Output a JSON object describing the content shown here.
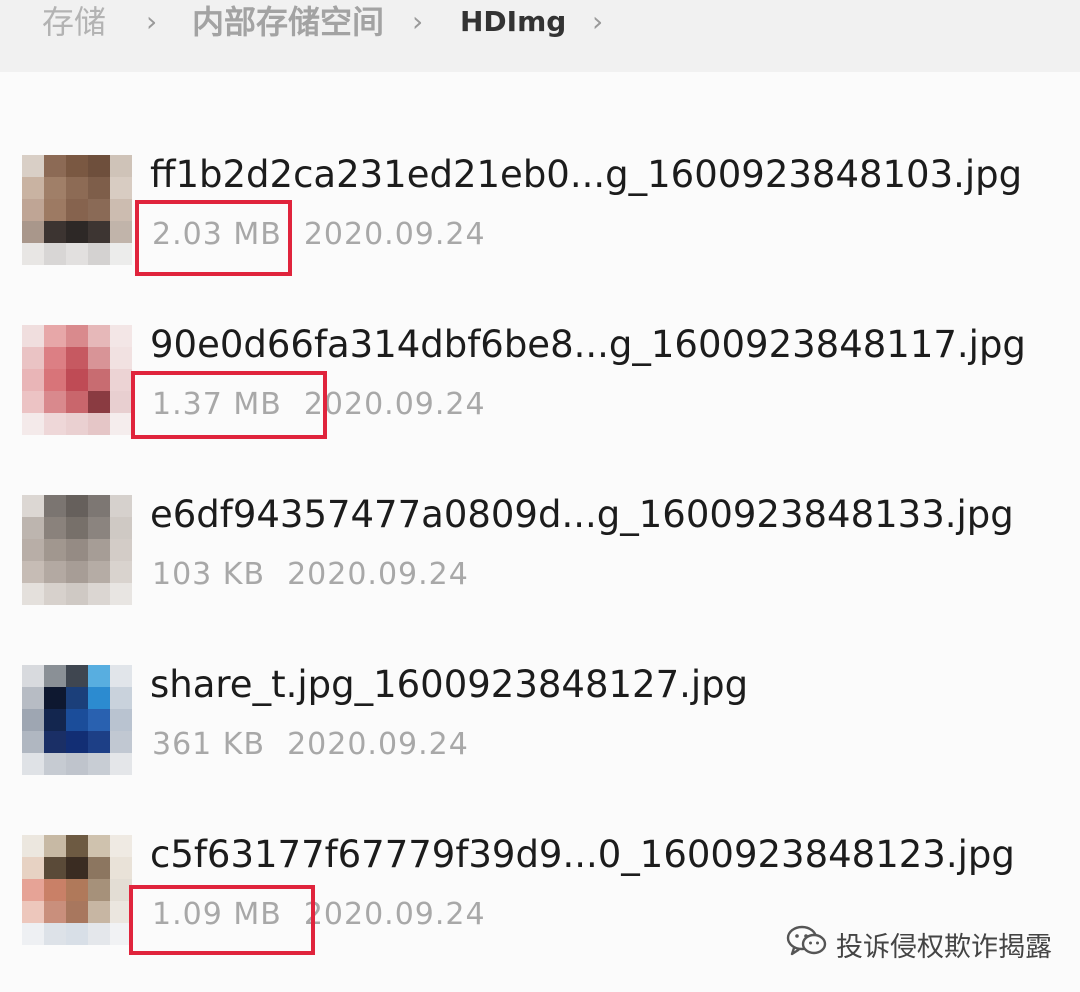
{
  "breadcrumb": {
    "root": "存储",
    "mid": "内部存储空间",
    "current": "HDImg"
  },
  "icons": {
    "separator": "chevron-right-icon",
    "watermark": "wechat-icon"
  },
  "colors": {
    "highlight": "#e0243c"
  },
  "files": [
    {
      "name": "ff1b2d2ca231ed21eb0...g_1600923848103.jpg",
      "size": "2.03 MB",
      "date": "2020.09.24",
      "highlighted": true
    },
    {
      "name": "90e0d66fa314dbf6be8...g_1600923848117.jpg",
      "size": "1.37 MB",
      "date": "2020.09.24",
      "highlighted": true
    },
    {
      "name": "e6df94357477a0809d...g_1600923848133.jpg",
      "size": "103 KB",
      "date": "2020.09.24",
      "highlighted": false
    },
    {
      "name": "share_t.jpg_1600923848127.jpg",
      "size": "361 KB",
      "date": "2020.09.24",
      "highlighted": false
    },
    {
      "name": "c5f63177f67779f39d9...0_1600923848123.jpg",
      "size": "1.09 MB",
      "date": "2020.09.24",
      "highlighted": true
    }
  ],
  "watermark": {
    "text": "投诉侵权欺诈揭露"
  }
}
